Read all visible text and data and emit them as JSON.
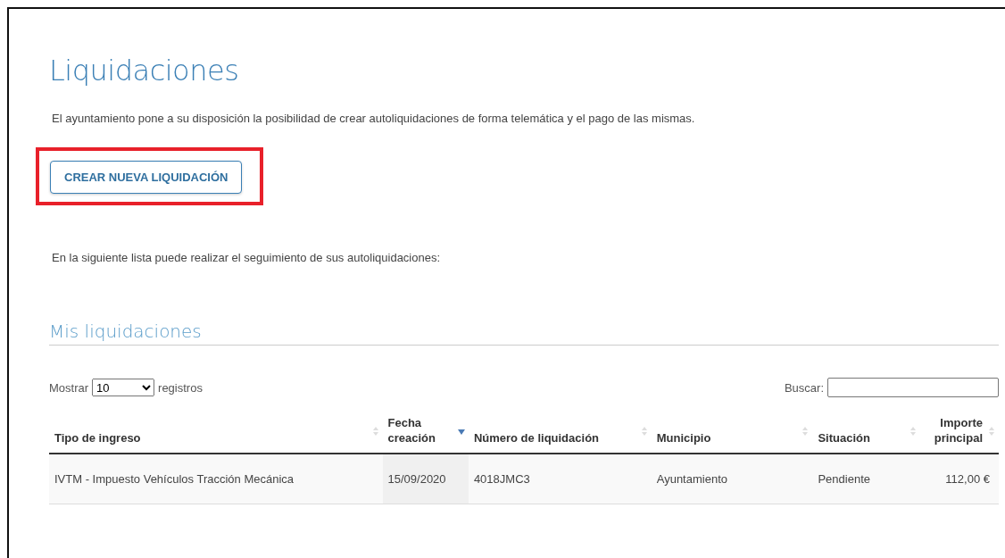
{
  "title": "Liquidaciones",
  "intro": "El ayuntamiento pone a su disposición la posibilidad de crear autoliquidaciones de forma telemática y el pago de las mismas.",
  "create_button": {
    "label": "CREAR NUEVA LIQUIDACIÓN",
    "highlighted": true
  },
  "list_intro": "En la siguiente lista puede realizar el seguimiento de sus autoliquidaciones:",
  "section_title": "Mis liquidaciones",
  "length_control": {
    "prefix": "Mostrar",
    "value": "10",
    "suffix": "registros"
  },
  "search": {
    "label": "Buscar:"
  },
  "table": {
    "columns": [
      {
        "label": "Tipo de ingreso",
        "sorted": false,
        "numeric": false
      },
      {
        "label": "Fecha creación",
        "sorted": true,
        "numeric": false
      },
      {
        "label": "Número de liquidación",
        "sorted": false,
        "numeric": false
      },
      {
        "label": "Municipio",
        "sorted": false,
        "numeric": false
      },
      {
        "label": "Situación",
        "sorted": false,
        "numeric": false
      },
      {
        "label": "Importe principal",
        "sorted": false,
        "numeric": true
      }
    ],
    "rows": [
      {
        "cells": [
          "IVTM - Impuesto Vehículos Tracción Mecánica",
          "15/09/2020",
          "4018JMC3",
          "Ayuntamiento",
          "Pendiente",
          "112,00 €"
        ]
      }
    ]
  }
}
